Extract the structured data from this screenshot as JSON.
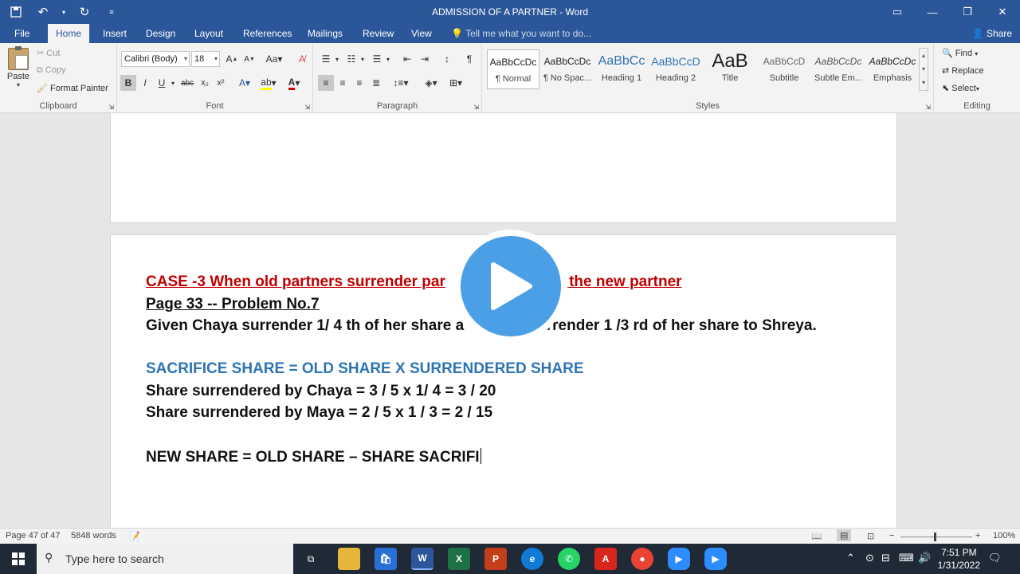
{
  "window": {
    "title": "ADMISSION OF A PARTNER - Word"
  },
  "tabs": {
    "items": [
      "File",
      "Home",
      "Insert",
      "Design",
      "Layout",
      "References",
      "Mailings",
      "Review",
      "View"
    ],
    "tell_me": "Tell me what you want to do...",
    "share": "Share"
  },
  "ribbon": {
    "clipboard": {
      "paste": "Paste",
      "cut": "Cut",
      "copy": "Copy",
      "format_painter": "Format Painter",
      "label": "Clipboard"
    },
    "font": {
      "name": "Calibri (Body)",
      "size": "18",
      "label": "Font"
    },
    "paragraph": {
      "label": "Paragraph"
    },
    "styles": {
      "items": [
        {
          "sample": "AaBbCcDc",
          "name": "¶ Normal"
        },
        {
          "sample": "AaBbCcDc",
          "name": "¶ No Spac..."
        },
        {
          "sample": "AaBbCc",
          "name": "Heading 1"
        },
        {
          "sample": "AaBbCcD",
          "name": "Heading 2"
        },
        {
          "sample": "AaB",
          "name": "Title"
        },
        {
          "sample": "AaBbCcD",
          "name": "Subtitle"
        },
        {
          "sample": "AaBbCcDc",
          "name": "Subtle Em..."
        },
        {
          "sample": "AaBbCcDc",
          "name": "Emphasis"
        }
      ],
      "label": "Styles"
    },
    "editing": {
      "find": "Find",
      "replace": "Replace",
      "select": "Select",
      "label": "Editing"
    }
  },
  "document": {
    "line1": "CASE -3 When old partners surrender par",
    "line1_end": "to the new partner",
    "line2": "Page 33 -- Problem No.7",
    "line3_a": "Given Chaya surrender 1/ 4 th of her share a",
    "line3_b": "urrender 1 /3 rd of her share to Shreya.",
    "line4": "SACRIFICE SHARE = OLD SHARE X SURRENDERED SHARE",
    "line5": "Share surrendered by Chaya = 3 / 5 x 1/ 4 = 3 / 20",
    "line6": "Share surrendered by Maya = 2 / 5 x  1 / 3 = 2 / 15",
    "line7": "NEW SHARE = OLD SHARE – SHARE SACRIFI"
  },
  "status": {
    "page": "Page 47 of 47",
    "words": "5848 words",
    "zoom": "100%"
  },
  "taskbar": {
    "search_placeholder": "Type here to search",
    "time": "7:51 PM",
    "date": "1/31/2022"
  },
  "colors": {
    "word_blue": "#2b579a",
    "heading_red": "#c00000",
    "formula_blue": "#2e74b5",
    "play_blue": "#4a9fe6"
  }
}
